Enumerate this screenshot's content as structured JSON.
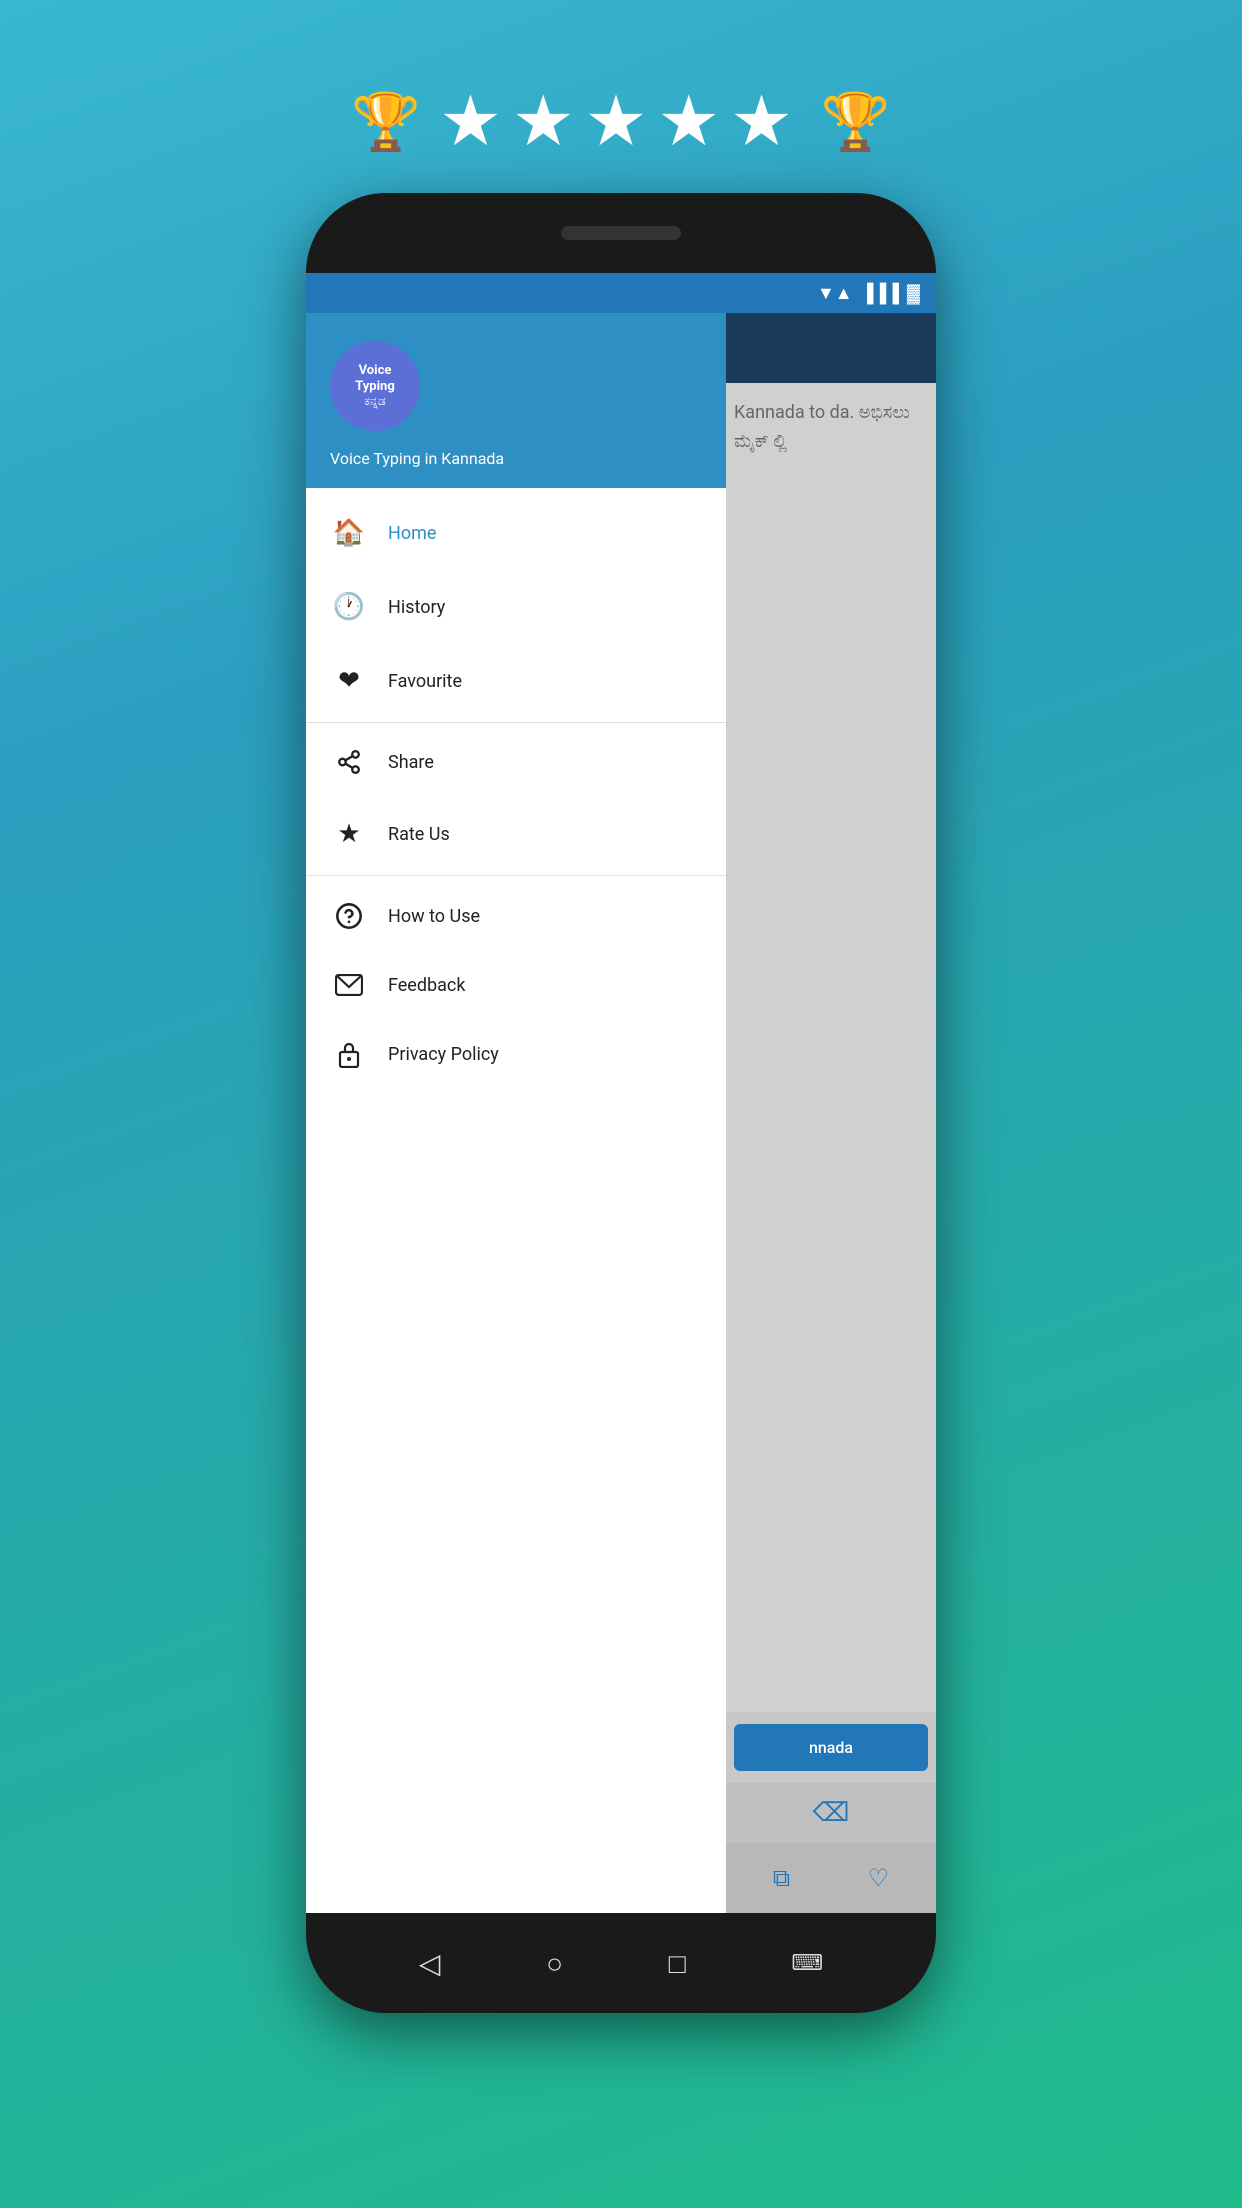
{
  "background": {
    "gradient_start": "#3ab8d0",
    "gradient_end": "#1fbb8a"
  },
  "rating": {
    "trophy_icon_left": "🏆",
    "trophy_icon_right": "🏆",
    "stars": "★★★★★"
  },
  "phone": {
    "status_bar": {
      "wifi": "▼",
      "signal": "▲",
      "battery": "▐"
    },
    "drawer": {
      "header": {
        "logo_line1": "Voice",
        "logo_line2": "Typing",
        "logo_line3": "ಕನ್ನಡ",
        "app_title": "Voice Typing in Kannada"
      },
      "menu_items": [
        {
          "id": "home",
          "label": "Home",
          "icon": "🏠",
          "active": true
        },
        {
          "id": "history",
          "label": "History",
          "icon": "🕐",
          "active": false
        },
        {
          "id": "favourite",
          "label": "Favourite",
          "icon": "❤",
          "active": false
        },
        {
          "id": "share",
          "label": "Share",
          "icon": "⤴",
          "active": false
        },
        {
          "id": "rate_us",
          "label": "Rate Us",
          "icon": "★",
          "active": false
        },
        {
          "id": "how_to_use",
          "label": "How to Use",
          "icon": "❓",
          "active": false
        },
        {
          "id": "feedback",
          "label": "Feedback",
          "icon": "✉",
          "active": false
        },
        {
          "id": "privacy_policy",
          "label": "Privacy Policy",
          "icon": "🔒",
          "active": false
        }
      ]
    },
    "right_content": {
      "main_text": "Kannada to da.\nಅಭಿಸಲು ಮೈಕ್\nಲ್ಲಿ",
      "speak_button": "nnada",
      "delete_icon": "⌫",
      "copy_icon": "⧉",
      "heart_icon": "♡"
    },
    "nav": {
      "back": "◁",
      "home": "○",
      "recent": "□",
      "keyboard": "⌨"
    }
  }
}
